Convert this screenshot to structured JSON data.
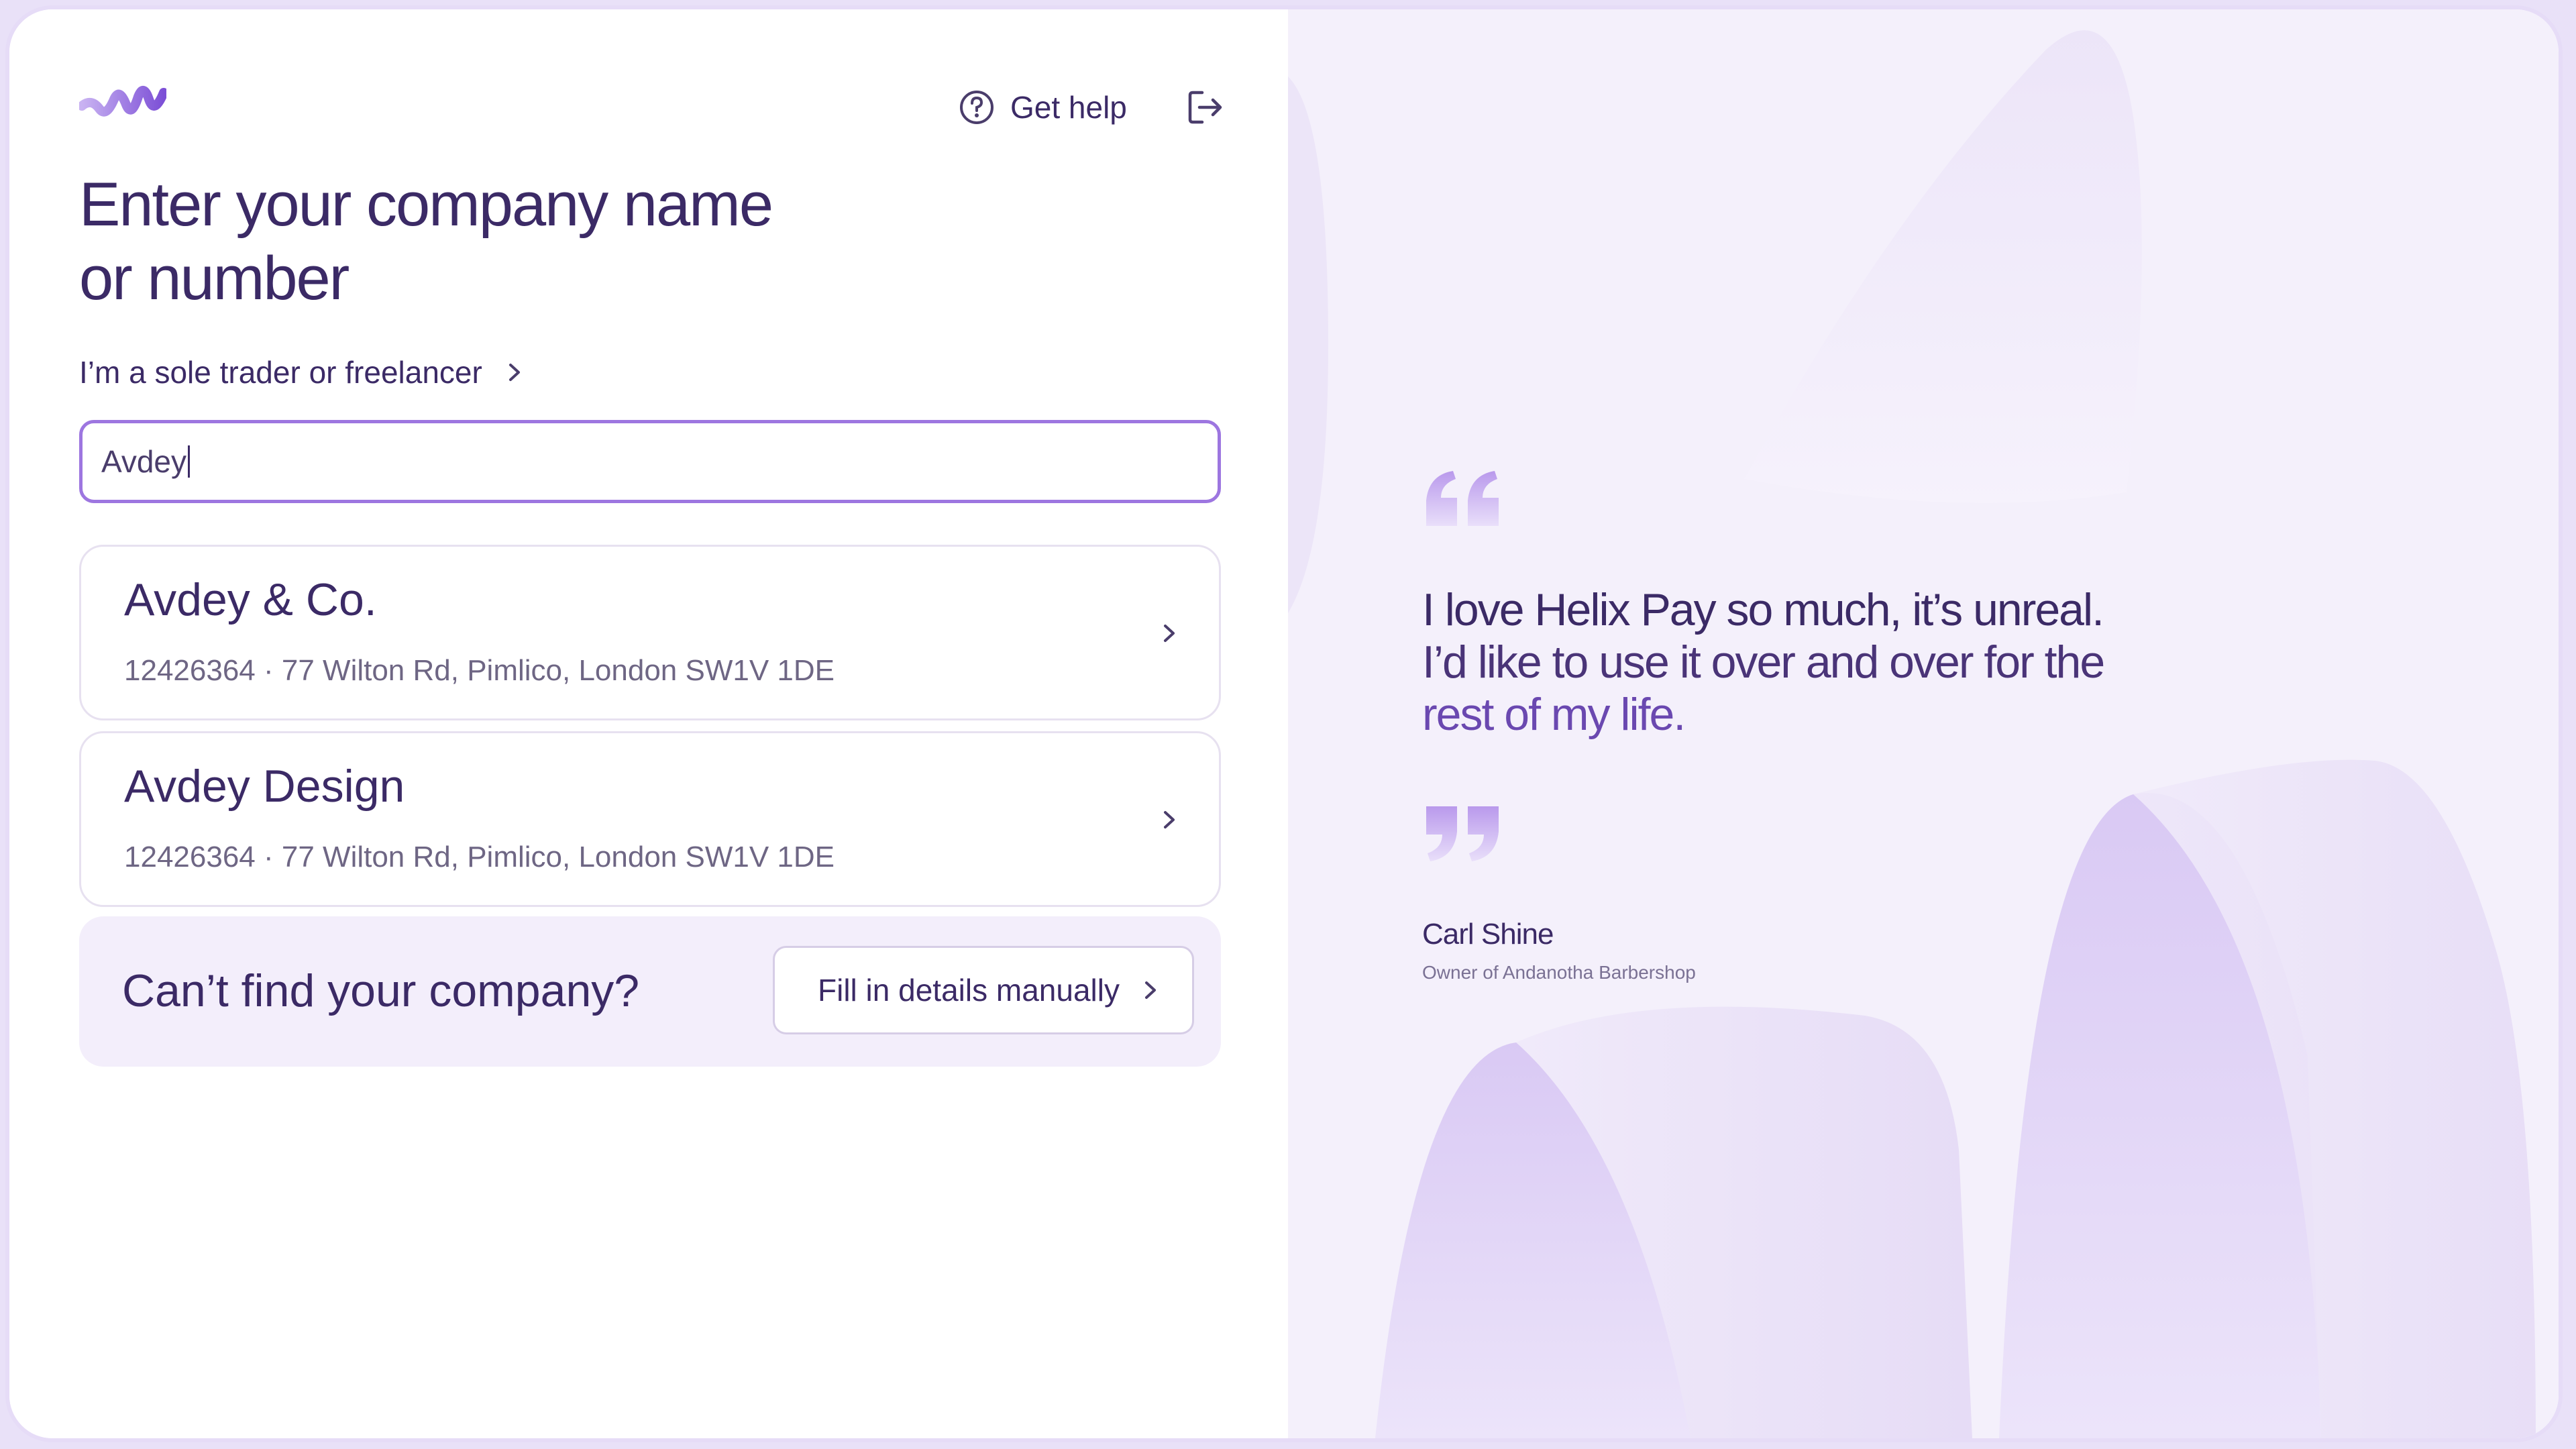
{
  "header": {
    "logo_icon": "helix-wave-logo-icon",
    "help_icon": "question-circle-icon",
    "help_label": "Get help",
    "signout_icon": "sign-out-icon"
  },
  "form": {
    "title_line1": "Enter your company name",
    "title_line2": "or number",
    "sole_trader_link": "I’m a sole trader or freelancer",
    "search_value": "Avdey",
    "results": [
      {
        "name": "Avdey & Co.",
        "meta": "12426364 · 77 Wilton Rd, Pimlico, London SW1V 1DE"
      },
      {
        "name": "Avdey Design",
        "meta": "12426364 · 77 Wilton Rd, Pimlico, London SW1V 1DE"
      }
    ],
    "cant_find_label": "Can’t find your company?",
    "manual_button": "Fill in details manually"
  },
  "testimonial": {
    "quote_line1": "I love Helix Pay so much, it’s unreal.",
    "quote_line2": "I’d like to use it over and over for the",
    "quote_line3": "rest of my life.",
    "author": "Carl Shine",
    "role": "Owner of Andanotha Barbershop"
  },
  "colors": {
    "primary_text": "#3b2a66",
    "accent": "#9d76e0",
    "muted_text": "#6e6684",
    "panel_bg": "#f4f0fb"
  }
}
